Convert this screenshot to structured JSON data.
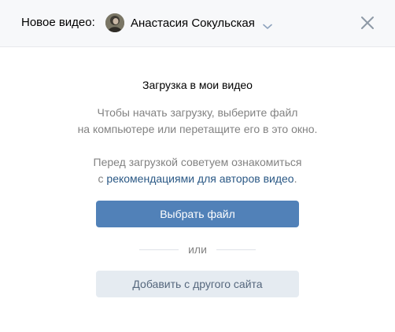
{
  "header": {
    "title": "Новое видео:",
    "owner_name": "Анастасия Сокульская"
  },
  "main": {
    "upload_title": "Загрузка в мои видео",
    "hint_line1": "Чтобы начать загрузку, выберите файл",
    "hint_line2": "на компьютере или перетащите его в это окно.",
    "advice_line1": "Перед загрузкой советуем ознакомиться",
    "advice_prefix": "с ",
    "advice_link": "рекомендациями для авторов видео",
    "advice_suffix": ".",
    "choose_file_label": "Выбрать файл",
    "or_label": "или",
    "add_from_site_label": "Добавить с другого сайта"
  },
  "colors": {
    "accent": "#5181b8",
    "link": "#2a5885",
    "secondary_button": "#e5ebf1",
    "muted_text": "#828282",
    "header_bg": "#f7f8fa"
  },
  "icons": {
    "owner_dropdown": "chevron-down-icon",
    "close": "close-icon",
    "avatar": "user-avatar"
  }
}
